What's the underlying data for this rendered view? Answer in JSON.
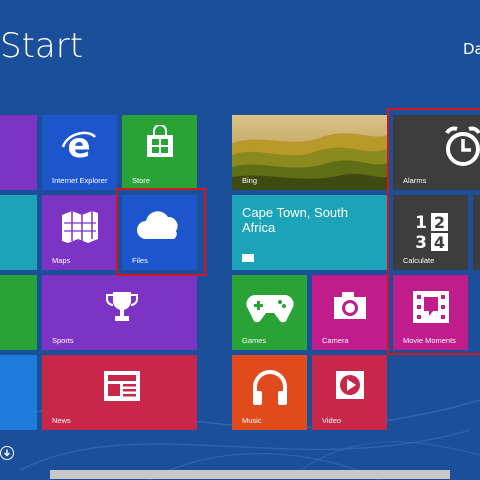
{
  "start_title": "Start",
  "user_name": "Da",
  "tiles": {
    "internet_explorer": "Internet Explorer",
    "store": "Store",
    "maps": "Maps",
    "files": "Files",
    "sports": "Sports",
    "news": "News",
    "bing": "Bing",
    "weather_city": "Cape Town, South Africa",
    "alarms": "Alarms",
    "calculate": "Calculate",
    "games": "Games",
    "camera": "Camera",
    "movie_moments": "Movie Moments",
    "music": "Music",
    "video": "Video"
  },
  "colors": {
    "background": "#1b4f9a",
    "purple": "#7d33c4",
    "teal": "#1ba3b8",
    "green": "#29a336",
    "blue": "#1d56cc",
    "crimson": "#c8274a",
    "magenta": "#c01c8c",
    "orange": "#e04a1c",
    "gray": "#3d3d3d",
    "highlight": "#d1171c"
  },
  "icons": [
    "internet-explorer-icon",
    "store-icon",
    "maps-icon",
    "cloud-icon",
    "trophy-icon",
    "newspaper-icon",
    "weather-icon",
    "alarm-clock-icon",
    "calculator-icon",
    "gamepad-icon",
    "camera-icon",
    "movie-moments-icon",
    "headphones-icon",
    "play-icon",
    "scroll-down-icon"
  ]
}
